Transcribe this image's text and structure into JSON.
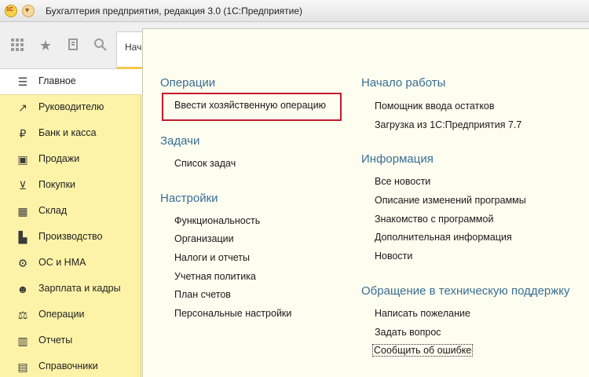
{
  "window": {
    "title": "Бухгалтерия предприятия, редакция 3.0  (1С:Предприятие)"
  },
  "toolbar": {
    "icons": [
      "apps-grid-icon",
      "star-icon",
      "history-icon",
      "search-icon"
    ],
    "tab_label": "Начальная страница"
  },
  "sidebar": {
    "items": [
      {
        "label": "Главное",
        "icon": "menu-icon",
        "active": true
      },
      {
        "label": "Руководителю",
        "icon": "trend-icon"
      },
      {
        "label": "Банк и касса",
        "icon": "ruble-icon"
      },
      {
        "label": "Продажи",
        "icon": "bag-icon"
      },
      {
        "label": "Покупки",
        "icon": "cart-icon"
      },
      {
        "label": "Склад",
        "icon": "warehouse-icon"
      },
      {
        "label": "Производство",
        "icon": "production-icon"
      },
      {
        "label": "ОС и НМА",
        "icon": "assets-icon"
      },
      {
        "label": "Зарплата и кадры",
        "icon": "people-icon"
      },
      {
        "label": "Операции",
        "icon": "operations-icon"
      },
      {
        "label": "Отчеты",
        "icon": "chart-icon"
      },
      {
        "label": "Справочники",
        "icon": "books-icon"
      }
    ]
  },
  "main": {
    "left": {
      "operations": {
        "title": "Операции",
        "links": [
          "Ввести хозяйственную операцию"
        ]
      },
      "tasks": {
        "title": "Задачи",
        "links": [
          "Список задач"
        ]
      },
      "settings": {
        "title": "Настройки",
        "links": [
          "Функциональность",
          "Организации",
          "Налоги и отчеты",
          "Учетная политика",
          "План счетов",
          "Персональные настройки"
        ]
      }
    },
    "right": {
      "start": {
        "title": "Начало работы",
        "links": [
          "Помощник ввода остатков",
          "Загрузка из 1С:Предприятия 7.7"
        ]
      },
      "info": {
        "title": "Информация",
        "links": [
          "Все новости",
          "Описание изменений программы",
          "Знакомство с программой",
          "Дополнительная информация",
          "Новости"
        ]
      },
      "support": {
        "title": "Обращение в техническую поддержку",
        "links": [
          "Написать пожелание",
          "Задать вопрос",
          "Сообщить об ошибке"
        ]
      }
    }
  },
  "colors": {
    "sidebar_bg": "#fdf3a8",
    "section_title": "#3a6e94",
    "highlight": "#c41a2a"
  }
}
